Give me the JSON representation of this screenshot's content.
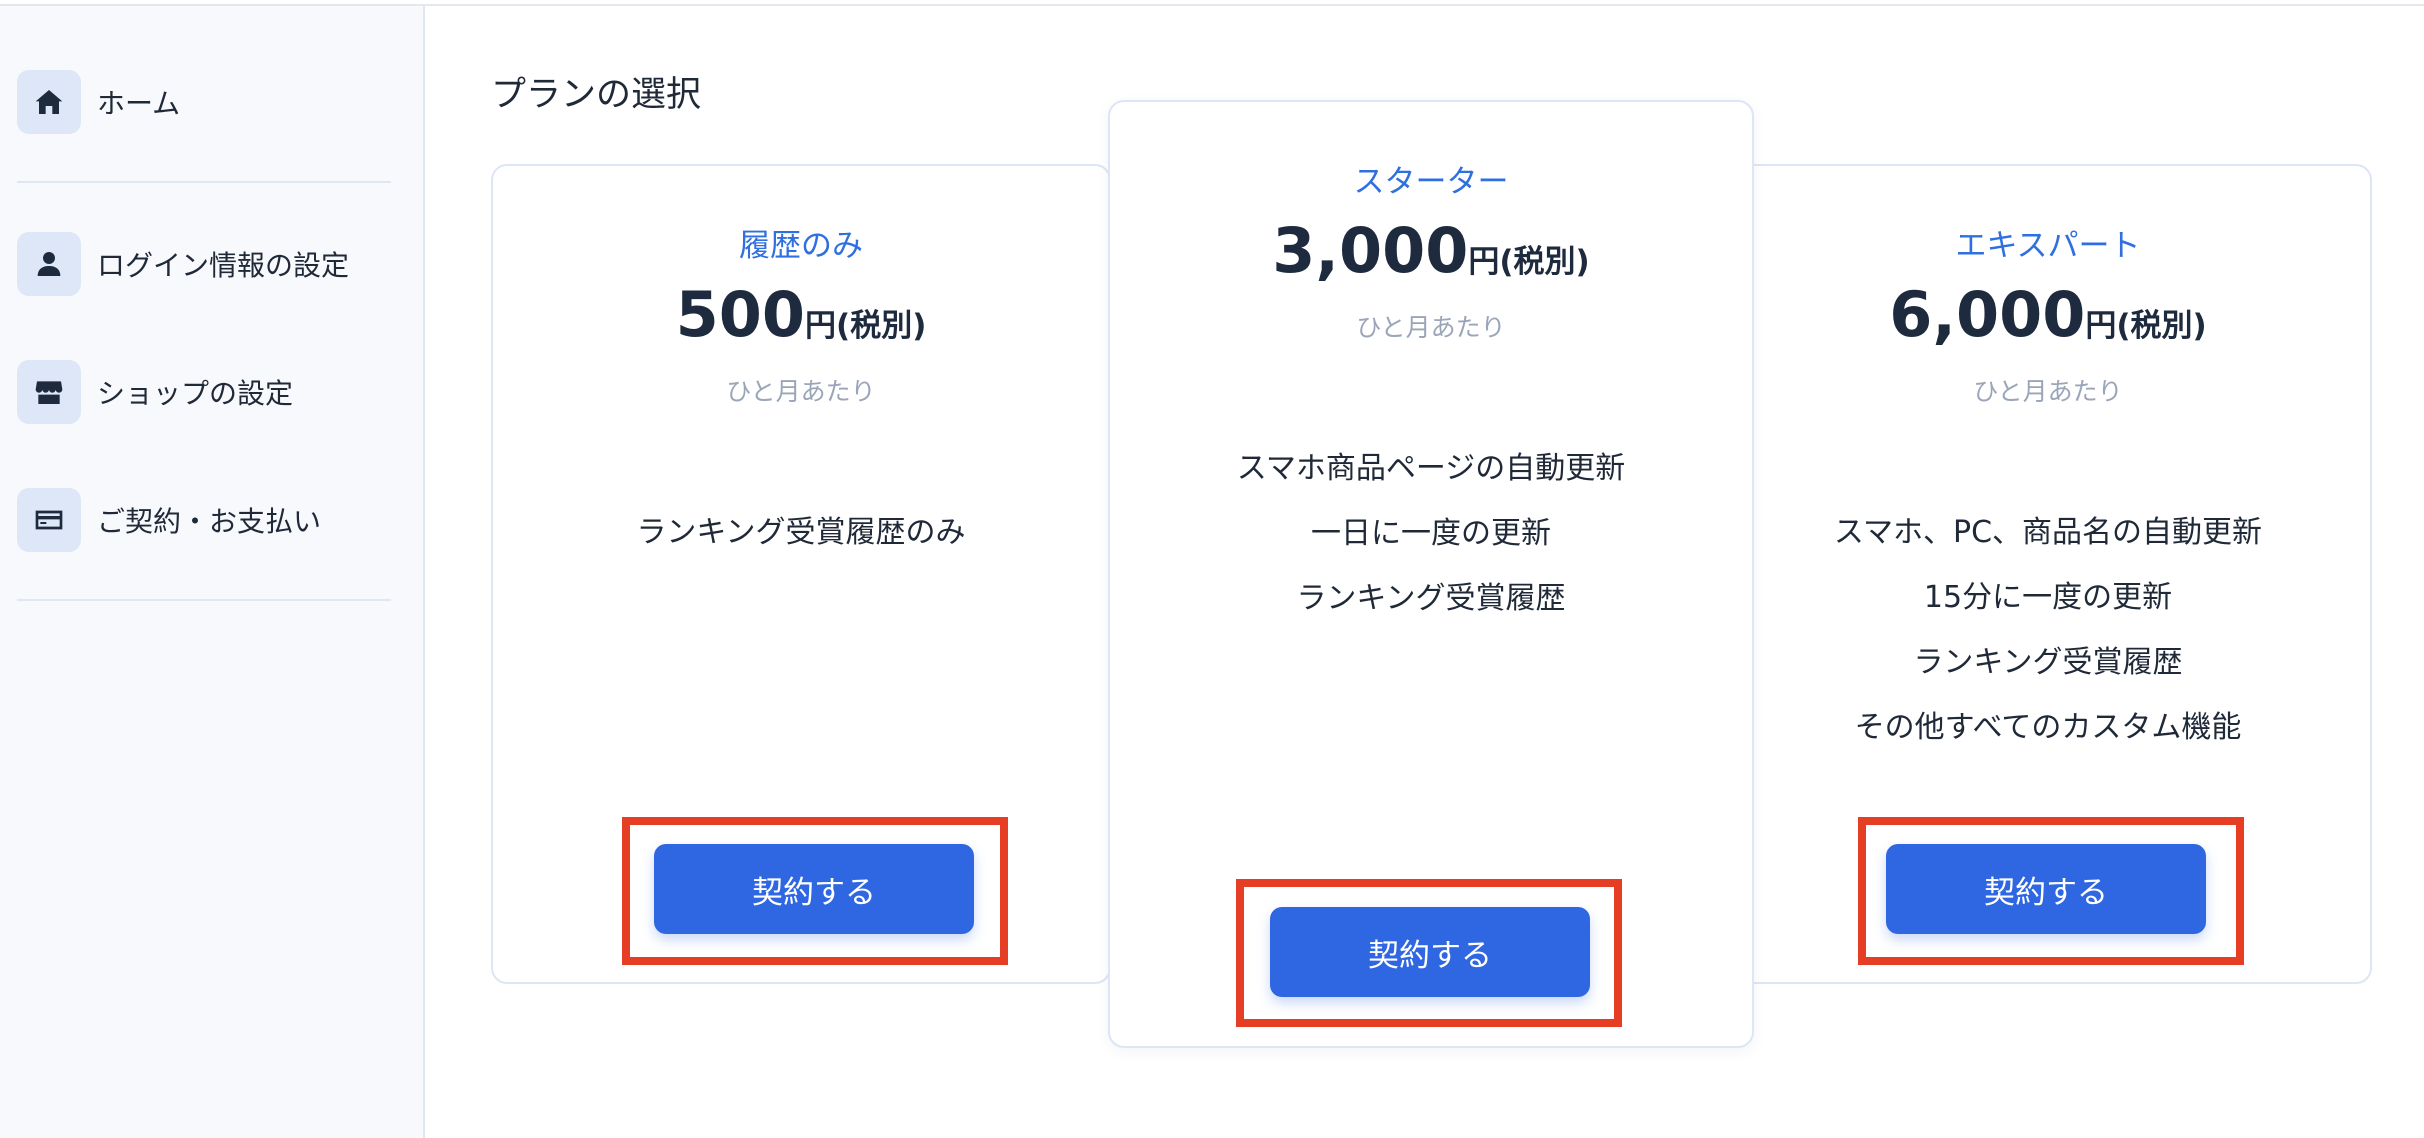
{
  "sidebar": {
    "items": [
      {
        "label": "ホーム",
        "icon": "home-icon"
      },
      {
        "label": "ログイン情報の設定",
        "icon": "user-icon"
      },
      {
        "label": "ショップの設定",
        "icon": "store-icon"
      },
      {
        "label": "ご契約・お支払い",
        "icon": "credit-card-icon"
      }
    ]
  },
  "main": {
    "title": "プランの選択",
    "plans": [
      {
        "name": "履歴のみ",
        "price": "500",
        "unit": "円(税別)",
        "period": "ひと月あたり",
        "features": [
          "ランキング受賞履歴のみ"
        ],
        "button_label": "契約する"
      },
      {
        "name": "スターター",
        "price": "3,000",
        "unit": "円(税別)",
        "period": "ひと月あたり",
        "features": [
          "スマホ商品ページの自動更新",
          "一日に一度の更新",
          "ランキング受賞履歴"
        ],
        "button_label": "契約する"
      },
      {
        "name": "エキスパート",
        "price": "6,000",
        "unit": "円(税別)",
        "period": "ひと月あたり",
        "features": [
          "スマホ、PC、商品名の自動更新",
          "15分に一度の更新",
          "ランキング受賞履歴",
          "その他すべてのカスタム機能"
        ],
        "button_label": "契約する"
      }
    ]
  },
  "colors": {
    "accent": "#2f66e1",
    "plan_name": "#2f6fe0",
    "highlight": "#e63d25",
    "sidebar_bg": "#f7f9fd"
  }
}
